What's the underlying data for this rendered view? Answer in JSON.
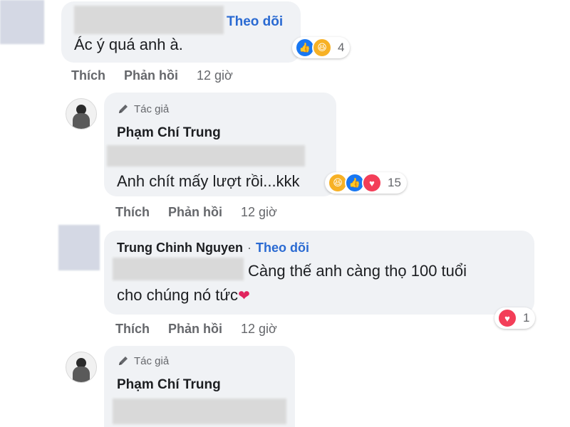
{
  "comments": [
    {
      "follow_label": "Theo dõi",
      "text": "Ác ý quá anh à.",
      "reaction_count": "4",
      "reactions": [
        "like-icon",
        "haha-icon"
      ],
      "actions": {
        "like": "Thích",
        "reply": "Phản hồi",
        "time": "12 giờ"
      }
    },
    {
      "author_badge": "Tác giả",
      "name": "Phạm Chí Trung",
      "text": "Anh chít mấy lượt rồi...kkk",
      "reaction_count": "15",
      "reactions": [
        "haha-icon",
        "like-icon",
        "love-icon"
      ],
      "actions": {
        "like": "Thích",
        "reply": "Phản hồi",
        "time": "12 giờ"
      }
    },
    {
      "name": "Trung Chinh Nguyen",
      "separator": "·",
      "follow_label": "Theo dõi",
      "text_line1": "Càng thế anh càng thọ 100 tuổi",
      "text_line2": "cho chúng nó tức",
      "heart": "❤",
      "reaction_count": "1",
      "reactions": [
        "love-icon"
      ],
      "actions": {
        "like": "Thích",
        "reply": "Phản hồi",
        "time": "12 giờ"
      }
    },
    {
      "author_badge": "Tác giả",
      "name": "Phạm Chí Trung"
    }
  ],
  "colors": {
    "bubble": "#f0f2f5",
    "link": "#2a6ad2",
    "meta": "#65676b",
    "like": "#1877f2",
    "haha": "#f7b125",
    "love": "#f33e58"
  }
}
